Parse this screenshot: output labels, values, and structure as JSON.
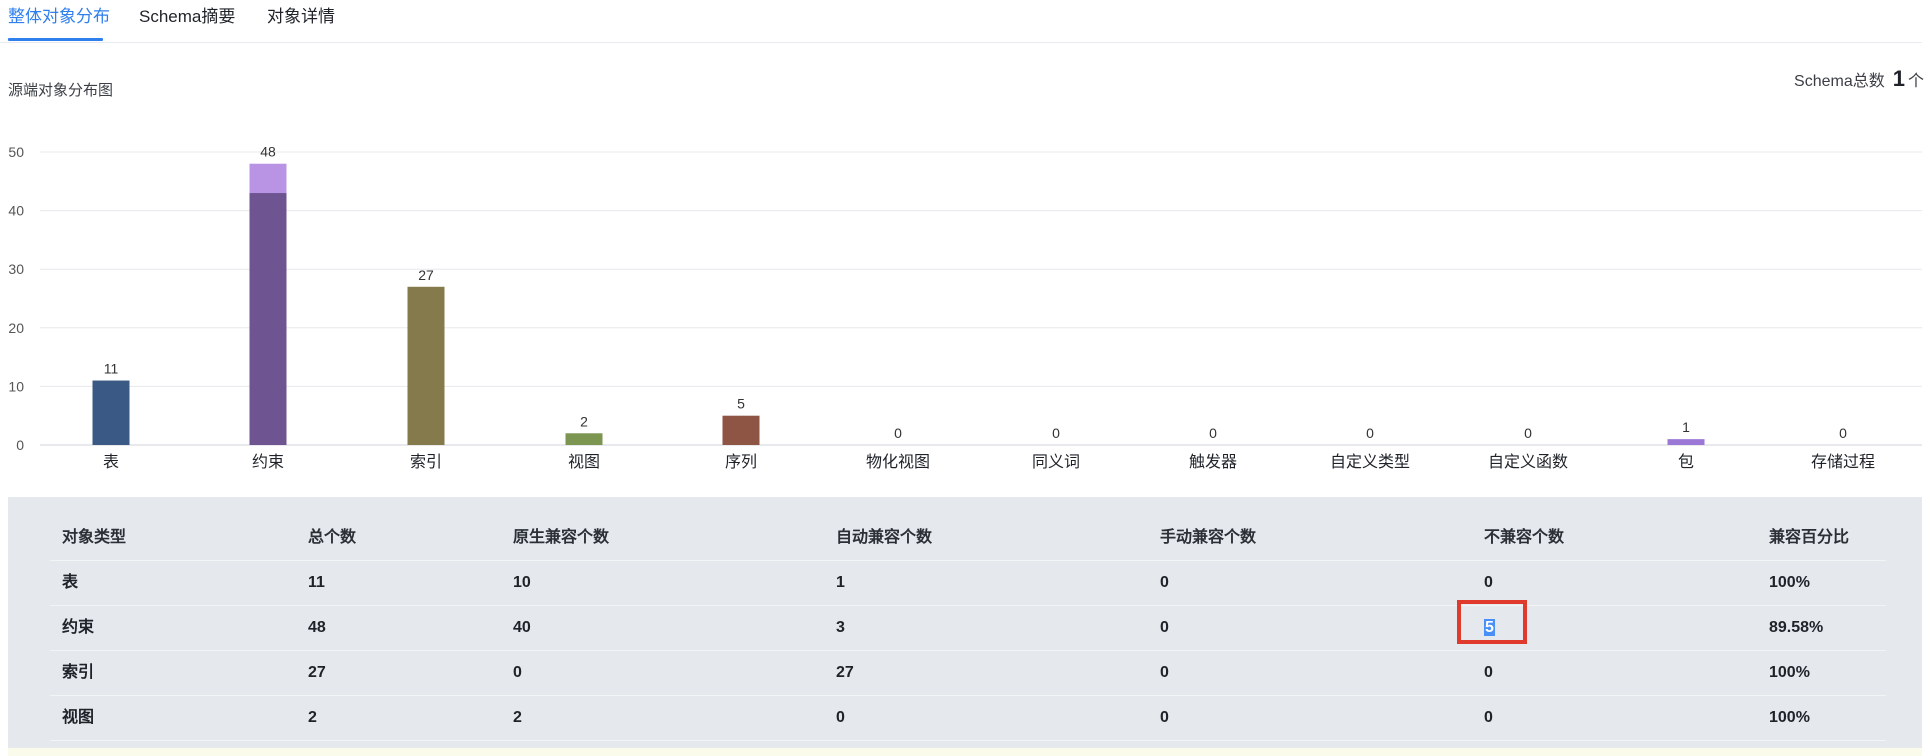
{
  "tabs": [
    {
      "label": "整体对象分布",
      "active": true
    },
    {
      "label": "Schema摘要",
      "active": false
    },
    {
      "label": "对象详情",
      "active": false
    }
  ],
  "chart_title": "源端对象分布图",
  "schema_total": {
    "label": "Schema总数",
    "value": "1",
    "unit": "个"
  },
  "colors": {
    "accent": "#2f80ed",
    "highlight_border": "#e03a2d",
    "table_bg": "#e5e8ec"
  },
  "chart_data": {
    "type": "bar",
    "stacked": true,
    "categories": [
      "表",
      "约束",
      "索引",
      "视图",
      "序列",
      "物化视图",
      "同义词",
      "触发器",
      "自定义类型",
      "自定义函数",
      "包",
      "存储过程"
    ],
    "totals": [
      11,
      48,
      27,
      2,
      5,
      0,
      0,
      0,
      0,
      0,
      1,
      0
    ],
    "series": [
      {
        "values": [
          11,
          43,
          27,
          2,
          5,
          0,
          0,
          0,
          0,
          0,
          0,
          0
        ],
        "colors": [
          "#3a5a85",
          "#6e5592",
          "#857a4b",
          "#7c9651",
          "#8e5444",
          "#888888",
          "#888888",
          "#888888",
          "#888888",
          "#888888",
          "#9b78d6",
          "#888888"
        ]
      },
      {
        "values": [
          0,
          5,
          0,
          0,
          0,
          0,
          0,
          0,
          0,
          0,
          1,
          0
        ],
        "colors": [
          "#6a8cc0",
          "#b994e4",
          "#b3a670",
          "#a9c07c",
          "#c07a66",
          "#aaaaaa",
          "#aaaaaa",
          "#aaaaaa",
          "#aaaaaa",
          "#aaaaaa",
          "#9b78d6",
          "#aaaaaa"
        ]
      }
    ],
    "yticks": [
      0,
      10,
      20,
      30,
      40,
      50
    ],
    "ylim": [
      0,
      50
    ],
    "grid": true,
    "title": "源端对象分布图"
  },
  "table": {
    "headers": [
      "对象类型",
      "总个数",
      "原生兼容个数",
      "自动兼容个数",
      "手动兼容个数",
      "不兼容个数",
      "兼容百分比"
    ],
    "rows": [
      [
        "表",
        "11",
        "10",
        "1",
        "0",
        "0",
        "100%"
      ],
      [
        "约束",
        "48",
        "40",
        "3",
        "0",
        "5",
        "89.58%"
      ],
      [
        "索引",
        "27",
        "0",
        "27",
        "0",
        "0",
        "100%"
      ],
      [
        "视图",
        "2",
        "2",
        "0",
        "0",
        "0",
        "100%"
      ]
    ]
  }
}
